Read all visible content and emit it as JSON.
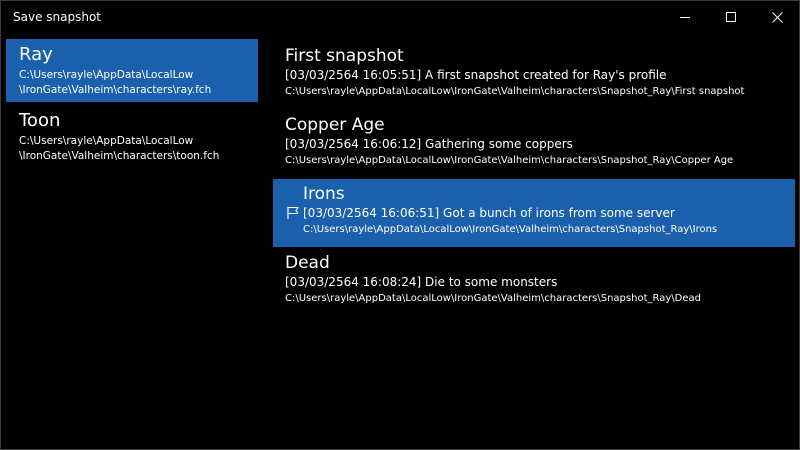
{
  "window": {
    "title": "Save snapshot"
  },
  "profiles": [
    {
      "name": "Ray",
      "path_line1": "C:\\Users\\rayle\\AppData\\LocalLow",
      "path_line2": "\\IronGate\\Valheim\\characters\\ray.fch",
      "selected": true
    },
    {
      "name": "Toon",
      "path_line1": "C:\\Users\\rayle\\AppData\\LocalLow",
      "path_line2": "\\IronGate\\Valheim\\characters\\toon.fch",
      "selected": false
    }
  ],
  "snapshots": [
    {
      "name": "First snapshot",
      "description": "[03/03/2564 16:05:51] A first snapshot created for Ray's profile",
      "path": "C:\\Users\\rayle\\AppData\\LocalLow\\IronGate\\Valheim\\characters\\Snapshot_Ray\\First snapshot",
      "selected": false
    },
    {
      "name": "Copper Age",
      "description": "[03/03/2564 16:06:12] Gathering some coppers",
      "path": "C:\\Users\\rayle\\AppData\\LocalLow\\IronGate\\Valheim\\characters\\Snapshot_Ray\\Copper Age",
      "selected": false
    },
    {
      "name": "Irons",
      "description": "[03/03/2564 16:06:51] Got a bunch of irons from some server",
      "path": "C:\\Users\\rayle\\AppData\\LocalLow\\IronGate\\Valheim\\characters\\Snapshot_Ray\\Irons",
      "selected": true,
      "icon": "flag-icon"
    },
    {
      "name": "Dead",
      "description": "[03/03/2564 16:08:24] Die to some monsters",
      "path": "C:\\Users\\rayle\\AppData\\LocalLow\\IronGate\\Valheim\\characters\\Snapshot_Ray\\Dead",
      "selected": false
    }
  ],
  "icons": {
    "minimize": "minimize-icon",
    "maximize": "maximize-icon",
    "close": "close-icon"
  },
  "colors": {
    "background": "#000000",
    "selection": "#1a60ac",
    "text": "#ffffff"
  }
}
